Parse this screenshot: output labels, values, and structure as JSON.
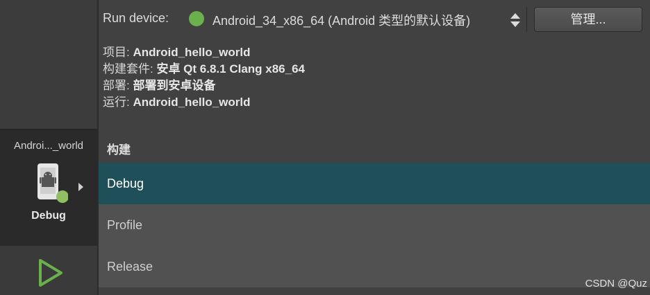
{
  "sidebar": {
    "project_name": "Androi..._world",
    "build_label": "Debug",
    "device_icon": "android-phone-icon",
    "run_icon": "run-triangle-icon"
  },
  "run_device": {
    "label": "Run device:",
    "value": "Android_34_x86_64 (Android 类型的默认设备)",
    "status_color": "#6ab04c",
    "manage_label": "管理..."
  },
  "info": {
    "project_key": "项目: ",
    "project_value": "Android_hello_world",
    "kit_key": "构建套件: ",
    "kit_value": "安卓 Qt 6.8.1 Clang x86_64",
    "deploy_key": "部署: ",
    "deploy_value": "部署到安卓设备",
    "run_key": "运行: ",
    "run_value": "Android_hello_world"
  },
  "build": {
    "header": "构建",
    "items": [
      {
        "label": "Debug",
        "selected": true
      },
      {
        "label": "Profile",
        "selected": false
      },
      {
        "label": "Release",
        "selected": false
      }
    ]
  },
  "watermark": "CSDN @Quz",
  "colors": {
    "accent_selected": "#1f4f59",
    "status_green": "#6ab04c"
  }
}
